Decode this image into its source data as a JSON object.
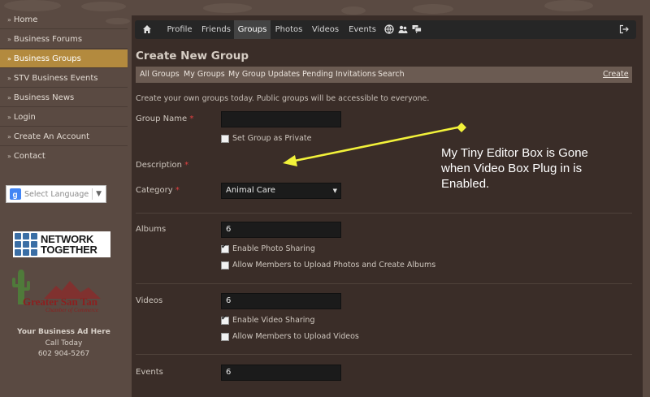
{
  "sidebar": {
    "items": [
      {
        "label": "Home",
        "active": false
      },
      {
        "label": "Business Forums",
        "active": false
      },
      {
        "label": "Business Groups",
        "active": true
      },
      {
        "label": "STV Business Events",
        "active": false
      },
      {
        "label": "Business News",
        "active": false
      },
      {
        "label": "Login",
        "active": false
      },
      {
        "label": "Create An Account",
        "active": false
      },
      {
        "label": "Contact",
        "active": false
      }
    ],
    "language": {
      "label": "Select Language",
      "arrow": "▼"
    },
    "sponsor1": {
      "line1": "NETWORK",
      "line2": "TOGETHER"
    },
    "sponsor2": {
      "name": "Greater San Tan",
      "sub": "Chamber of Commerce"
    },
    "ad": {
      "title": "Your Business Ad Here",
      "line2": "Call Today",
      "phone": "602 904-5267"
    }
  },
  "topbar": {
    "items": [
      "Profile",
      "Friends",
      "Groups",
      "Photos",
      "Videos",
      "Events"
    ],
    "active": "Groups",
    "icons": [
      "home-icon",
      "globe-icon",
      "users-icon",
      "chat-icon",
      "logout-icon"
    ]
  },
  "page": {
    "title": "Create New Group",
    "subnav": [
      "All Groups",
      "My Groups",
      "My Group Updates",
      "Pending Invitations",
      "Search"
    ],
    "create": "Create",
    "intro": "Create your own groups today. Public groups will be accessible to everyone."
  },
  "form": {
    "group_name": {
      "label": "Group Name",
      "required": "*",
      "value": ""
    },
    "private": {
      "label": "Set Group as Private",
      "checked": false
    },
    "description": {
      "label": "Description",
      "required": "*"
    },
    "category": {
      "label": "Category",
      "required": "*",
      "value": "Animal Care"
    },
    "albums": {
      "label": "Albums",
      "value": "6"
    },
    "photo_sharing": {
      "label": "Enable Photo Sharing",
      "checked": true
    },
    "members_photos": {
      "label": "Allow Members to Upload Photos and Create Albums",
      "checked": false
    },
    "videos": {
      "label": "Videos",
      "value": "6"
    },
    "video_sharing": {
      "label": "Enable Video Sharing",
      "checked": true
    },
    "members_videos": {
      "label": "Allow Members to Upload Videos",
      "checked": false
    },
    "events": {
      "label": "Events",
      "value": "6"
    }
  },
  "annotation": {
    "text": "My Tiny Editor Box is Gone when Video Box Plug in is Enabled.",
    "color": "#f2f23a"
  },
  "colors": {
    "accent": "#b38a3e",
    "required": "#e04040",
    "arrow": "#f2f23a"
  }
}
